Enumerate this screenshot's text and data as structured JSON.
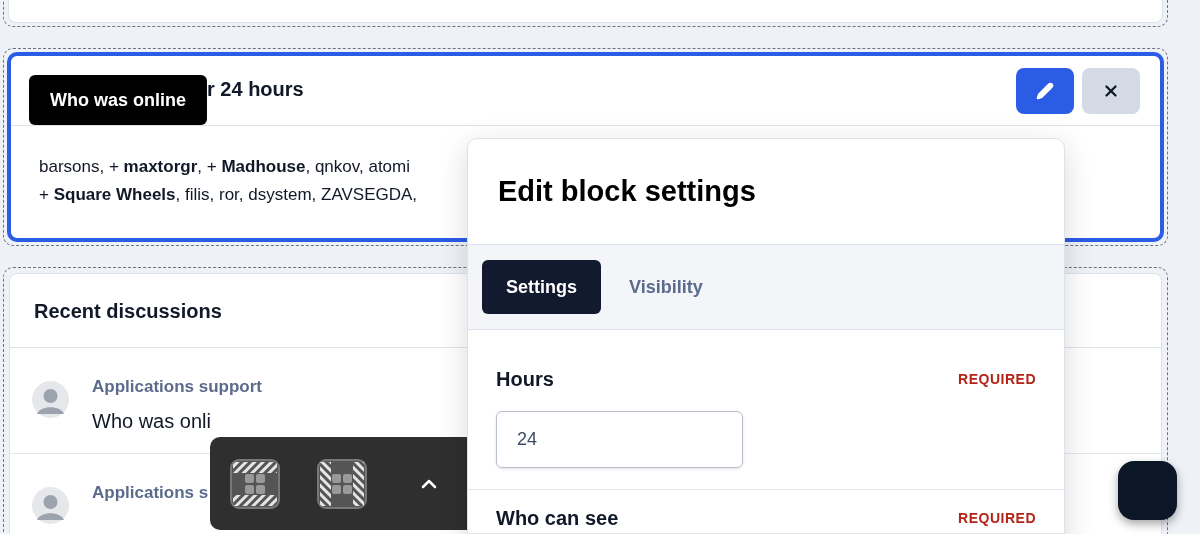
{
  "online_block": {
    "selected": true,
    "title": "r 24 hours",
    "tooltip": "Who was online",
    "lines": [
      "barsons, + **maxtorgr**, + **Madhouse**, qnkov, atomi",
      "+ **Square Wheels**, filis, ror, dsystem, ZAVSEGDA,"
    ],
    "buttons": [
      {
        "kind": "edit",
        "selected": true
      },
      {
        "kind": "close",
        "selected": false
      }
    ]
  },
  "discussions": {
    "title": "Recent discussions",
    "items": [
      {
        "category": "Applications support",
        "title": "Who was onli"
      },
      {
        "category": "Applications s"
      }
    ]
  },
  "popover": {
    "title": "Edit block settings",
    "tabs": [
      {
        "label": "Settings",
        "selected": true
      },
      {
        "label": "Visibility",
        "selected": false
      }
    ],
    "fields": [
      {
        "label": "Hours",
        "badge": "REQUIRED",
        "value": "24"
      },
      {
        "label": "Who can see",
        "badge": "REQUIRED"
      }
    ]
  }
}
